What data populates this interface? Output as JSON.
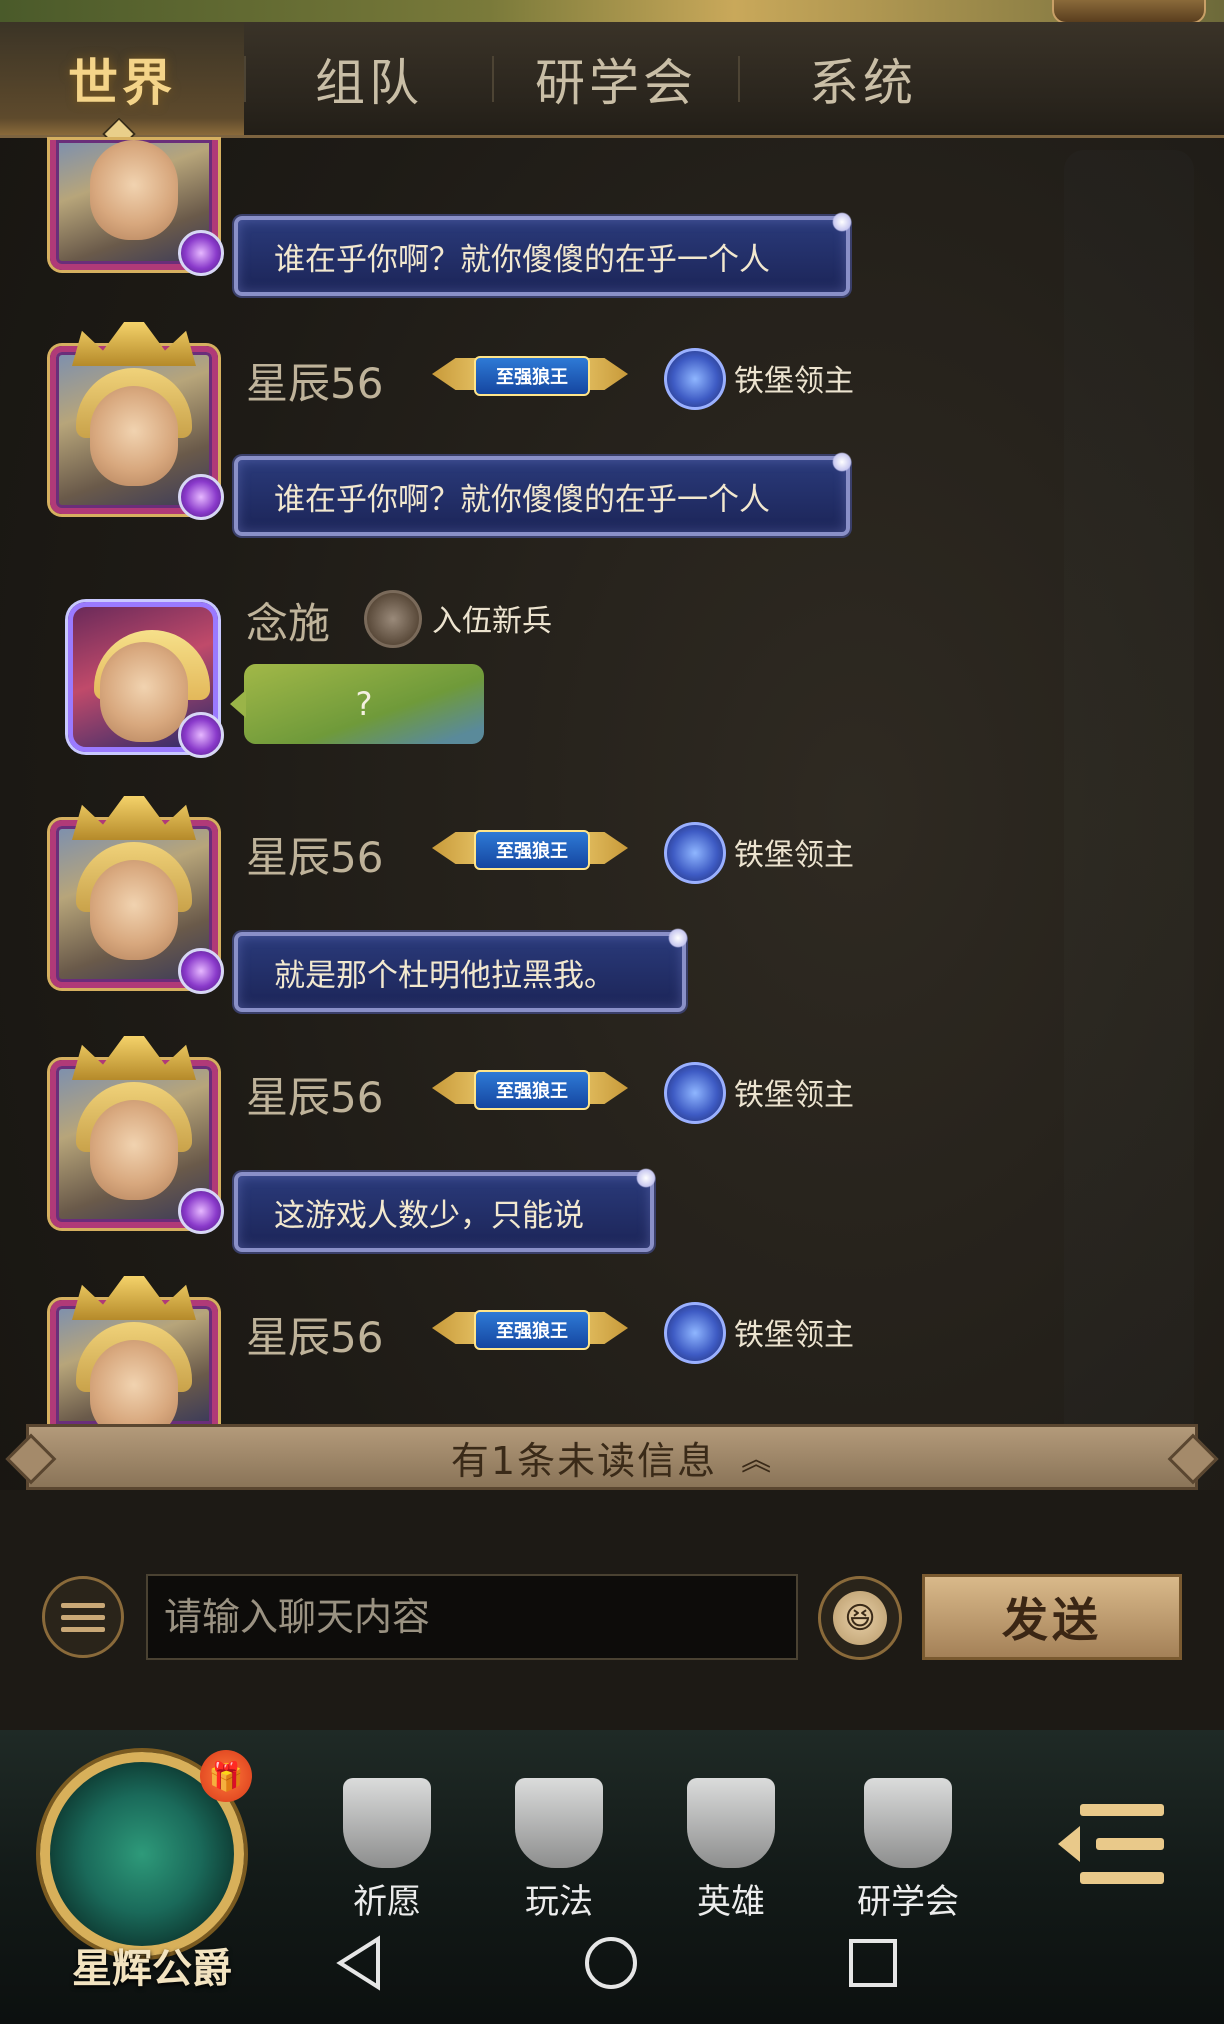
{
  "tabs": [
    {
      "label": "世界"
    },
    {
      "label": "组队"
    },
    {
      "label": "研学会"
    },
    {
      "label": "系统"
    }
  ],
  "messages": [
    {
      "name": "",
      "text": "谁在乎你啊？就你傻傻的在乎一个人"
    },
    {
      "name": "星辰56",
      "title_badge": "至强狼王",
      "rank": "铁堡领主",
      "text": "谁在乎你啊？就你傻傻的在乎一个人"
    },
    {
      "name": "念施",
      "rank": "入伍新兵",
      "text": "?"
    },
    {
      "name": "星辰56",
      "title_badge": "至强狼王",
      "rank": "铁堡领主",
      "text": "就是那个杜明他拉黑我。"
    },
    {
      "name": "星辰56",
      "title_badge": "至强狼王",
      "rank": "铁堡领主",
      "text": "这游戏人数少，只能说"
    },
    {
      "name": "星辰56",
      "title_badge": "至强狼王",
      "rank": "铁堡领主",
      "text": ""
    }
  ],
  "unread": {
    "label": "有1条未读信息",
    "chevron": "︽"
  },
  "input": {
    "placeholder": "请输入聊天内容",
    "emoji_glyph": "😆"
  },
  "send": {
    "label": "发送"
  },
  "bottom_nav": {
    "logo_label": "星辉公爵",
    "gift_glyph": "🎁",
    "items": [
      {
        "label": "祈愿",
        "icon": "wish-icon"
      },
      {
        "label": "玩法",
        "icon": "gameplay-icon"
      },
      {
        "label": "英雄",
        "icon": "hero-icon"
      },
      {
        "label": "研学会",
        "icon": "academy-icon"
      }
    ]
  },
  "colors": {
    "accent_gold": "#f4d489",
    "bubble_blue": "#1c2558",
    "send_button": "#d9b98a"
  }
}
